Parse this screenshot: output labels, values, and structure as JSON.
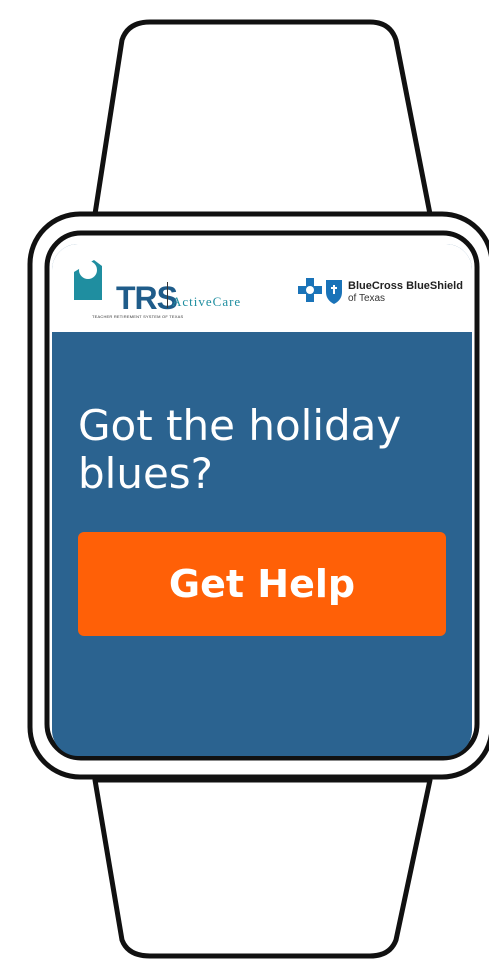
{
  "header": {
    "trs_logo_text": "TRS",
    "activecare_text": "ActiveCare",
    "trs_subtitle": "TEACHER RETIREMENT SYSTEM OF TEXAS",
    "bcbs_name": "BlueCross BlueShield",
    "bcbs_sub": "of Texas"
  },
  "ad": {
    "headline": "Got the holiday blues?",
    "cta_label": "Get Help"
  },
  "colors": {
    "screen_bg": "#2b6390",
    "cta_bg": "#ff6007",
    "trs_blue": "#1f5c8a",
    "activecare_teal": "#1f8ea0",
    "bcbs_blue": "#1a73b8"
  }
}
